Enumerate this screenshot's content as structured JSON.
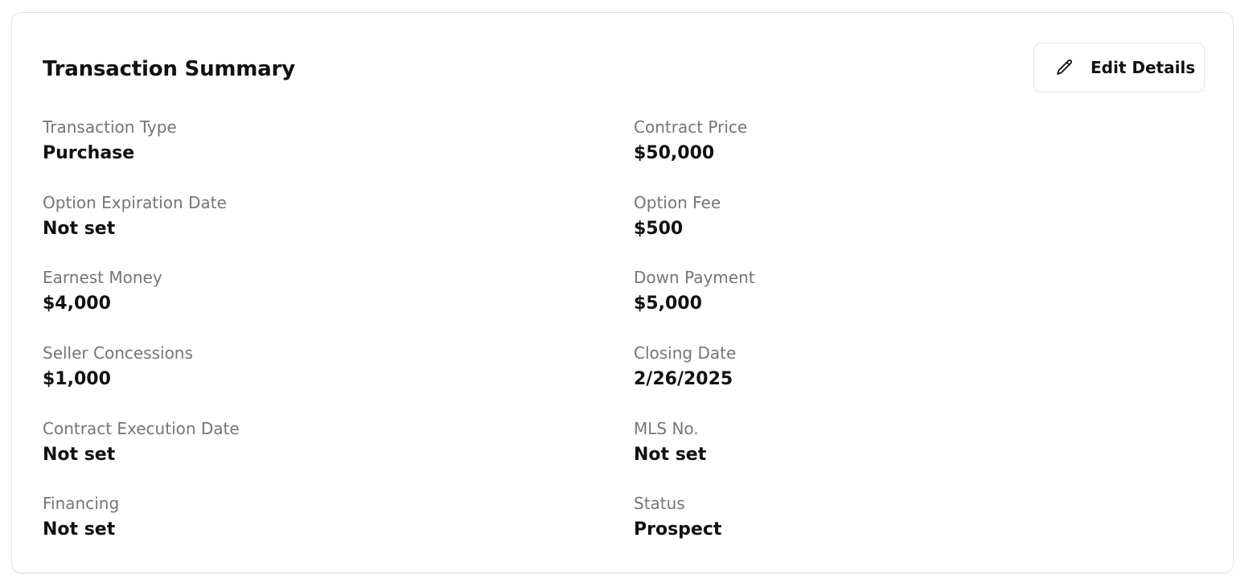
{
  "card": {
    "title": "Transaction Summary",
    "edit_button": {
      "label": "Edit Details",
      "icon": "pencil-icon"
    }
  },
  "fields_left": [
    {
      "label": "Transaction Type",
      "value": "Purchase"
    },
    {
      "label": "Option Expiration Date",
      "value": "Not set"
    },
    {
      "label": "Earnest Money",
      "value": "$4,000"
    },
    {
      "label": "Seller Concessions",
      "value": "$1,000"
    },
    {
      "label": "Contract Execution Date",
      "value": "Not set"
    },
    {
      "label": "Financing",
      "value": "Not set"
    }
  ],
  "fields_right": [
    {
      "label": "Contract Price",
      "value": "$50,000"
    },
    {
      "label": "Option Fee",
      "value": "$500"
    },
    {
      "label": "Down Payment",
      "value": "$5,000"
    },
    {
      "label": "Closing Date",
      "value": "2/26/2025"
    },
    {
      "label": "MLS No.",
      "value": "Not set"
    },
    {
      "label": "Status",
      "value": "Prospect"
    }
  ]
}
